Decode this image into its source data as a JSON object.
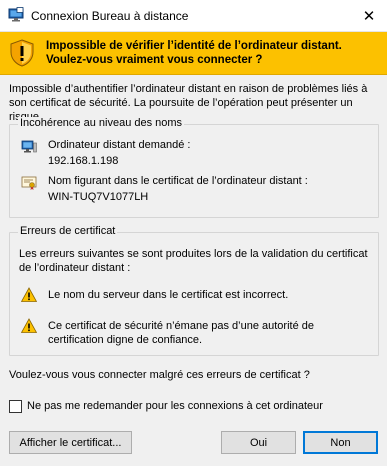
{
  "window": {
    "title": "Connexion Bureau à distance",
    "close_glyph": "✕"
  },
  "banner": {
    "line1": "Impossible de vérifier l’identité de l’ordinateur distant.",
    "line2": "Voulez-vous vraiment vous connecter ?",
    "color": "#fcc100"
  },
  "intro": "Impossible d’authentifier l’ordinateur distant en raison de problèmes liés à son certificat de sécurité. La poursuite de l’opération peut présenter un risque.",
  "name_mismatch": {
    "legend": "Incohérence au niveau des noms",
    "requested_label": "Ordinateur distant demandé :",
    "requested_value": "192.168.1.198",
    "cert_label": "Nom figurant dans le certificat de l’ordinateur distant :",
    "cert_value": "WIN-TUQ7V1077LH"
  },
  "cert_errors": {
    "legend": "Erreurs de certificat",
    "description": "Les erreurs suivantes se sont produites lors de la validation du certificat de l’ordinateur distant :",
    "errors": [
      "Le nom du serveur dans le certificat est incorrect.",
      "Ce certificat de sécurité n’émane pas d’une autorité de certification digne de confiance."
    ]
  },
  "question": "Voulez-vous vous connecter malgré ces erreurs de certificat ?",
  "checkbox": {
    "label": "Ne pas me redemander pour les connexions à cet ordinateur",
    "checked": false
  },
  "buttons": {
    "view_certificate": "Afficher le certificat...",
    "yes": "Oui",
    "no": "Non"
  }
}
